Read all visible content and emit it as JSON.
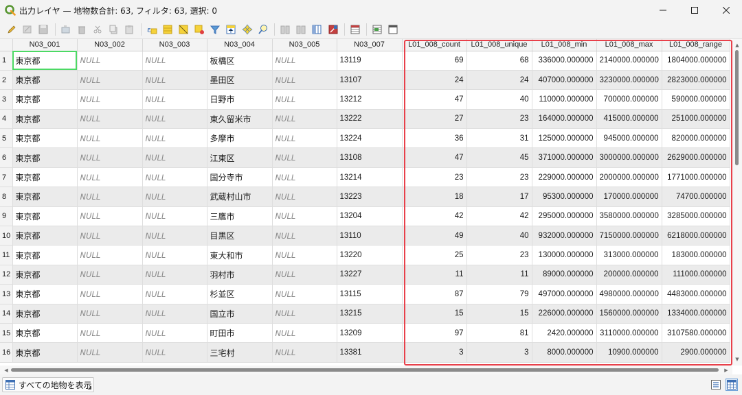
{
  "window": {
    "title": "出力レイヤ — 地物数合計: 63, フィルタ: 63, 選択: 0",
    "minimize_icon": "minimize-icon",
    "maximize_icon": "maximize-icon",
    "close_icon": "close-icon"
  },
  "toolbar": {
    "items": [
      {
        "icon": "pencil-icon"
      },
      {
        "icon": "multi-edit-icon"
      },
      {
        "icon": "save-icon"
      },
      {
        "sep": true
      },
      {
        "icon": "add-feature-icon"
      },
      {
        "icon": "delete-icon"
      },
      {
        "icon": "cut-icon"
      },
      {
        "icon": "copy-icon"
      },
      {
        "icon": "paste-icon"
      },
      {
        "sep": true
      },
      {
        "icon": "expression-select-icon"
      },
      {
        "icon": "select-all-icon"
      },
      {
        "icon": "invert-selection-icon"
      },
      {
        "icon": "deselect-icon"
      },
      {
        "icon": "filter-icon"
      },
      {
        "icon": "move-selection-top-icon"
      },
      {
        "icon": "pan-to-selection-icon"
      },
      {
        "icon": "zoom-to-selection-icon"
      },
      {
        "sep": true
      },
      {
        "icon": "new-field-icon"
      },
      {
        "icon": "delete-field-icon"
      },
      {
        "icon": "organize-columns-icon"
      },
      {
        "icon": "field-calculator-icon"
      },
      {
        "sep": true
      },
      {
        "icon": "conditional-format-icon"
      },
      {
        "sep": true
      },
      {
        "icon": "actions-icon"
      },
      {
        "icon": "dock-icon"
      }
    ]
  },
  "table": {
    "columns": [
      "N03_001",
      "N03_002",
      "N03_003",
      "N03_004",
      "N03_005",
      "N03_007",
      "L01_008_count",
      "L01_008_unique",
      "L01_008_min",
      "L01_008_max",
      "L01_008_range"
    ],
    "rows": [
      {
        "n": "1",
        "c": [
          "東京都",
          "NULL",
          "NULL",
          "板橋区",
          "NULL",
          "13119",
          "69",
          "68",
          "336000.000000",
          "2140000.000000",
          "1804000.000000"
        ]
      },
      {
        "n": "2",
        "c": [
          "東京都",
          "NULL",
          "NULL",
          "墨田区",
          "NULL",
          "13107",
          "24",
          "24",
          "407000.000000",
          "3230000.000000",
          "2823000.000000"
        ]
      },
      {
        "n": "3",
        "c": [
          "東京都",
          "NULL",
          "NULL",
          "日野市",
          "NULL",
          "13212",
          "47",
          "40",
          "110000.000000",
          "700000.000000",
          "590000.000000"
        ]
      },
      {
        "n": "4",
        "c": [
          "東京都",
          "NULL",
          "NULL",
          "東久留米市",
          "NULL",
          "13222",
          "27",
          "23",
          "164000.000000",
          "415000.000000",
          "251000.000000"
        ]
      },
      {
        "n": "5",
        "c": [
          "東京都",
          "NULL",
          "NULL",
          "多摩市",
          "NULL",
          "13224",
          "36",
          "31",
          "125000.000000",
          "945000.000000",
          "820000.000000"
        ]
      },
      {
        "n": "6",
        "c": [
          "東京都",
          "NULL",
          "NULL",
          "江東区",
          "NULL",
          "13108",
          "47",
          "45",
          "371000.000000",
          "3000000.000000",
          "2629000.000000"
        ]
      },
      {
        "n": "7",
        "c": [
          "東京都",
          "NULL",
          "NULL",
          "国分寺市",
          "NULL",
          "13214",
          "23",
          "23",
          "229000.000000",
          "2000000.000000",
          "1771000.000000"
        ]
      },
      {
        "n": "8",
        "c": [
          "東京都",
          "NULL",
          "NULL",
          "武蔵村山市",
          "NULL",
          "13223",
          "18",
          "17",
          "95300.000000",
          "170000.000000",
          "74700.000000"
        ]
      },
      {
        "n": "9",
        "c": [
          "東京都",
          "NULL",
          "NULL",
          "三鷹市",
          "NULL",
          "13204",
          "42",
          "42",
          "295000.000000",
          "3580000.000000",
          "3285000.000000"
        ]
      },
      {
        "n": "10",
        "c": [
          "東京都",
          "NULL",
          "NULL",
          "目黒区",
          "NULL",
          "13110",
          "49",
          "40",
          "932000.000000",
          "7150000.000000",
          "6218000.000000"
        ]
      },
      {
        "n": "11",
        "c": [
          "東京都",
          "NULL",
          "NULL",
          "東大和市",
          "NULL",
          "13220",
          "25",
          "23",
          "130000.000000",
          "313000.000000",
          "183000.000000"
        ]
      },
      {
        "n": "12",
        "c": [
          "東京都",
          "NULL",
          "NULL",
          "羽村市",
          "NULL",
          "13227",
          "11",
          "11",
          "89000.000000",
          "200000.000000",
          "111000.000000"
        ]
      },
      {
        "n": "13",
        "c": [
          "東京都",
          "NULL",
          "NULL",
          "杉並区",
          "NULL",
          "13115",
          "87",
          "79",
          "497000.000000",
          "4980000.000000",
          "4483000.000000"
        ]
      },
      {
        "n": "14",
        "c": [
          "東京都",
          "NULL",
          "NULL",
          "国立市",
          "NULL",
          "13215",
          "15",
          "15",
          "226000.000000",
          "1560000.000000",
          "1334000.000000"
        ]
      },
      {
        "n": "15",
        "c": [
          "東京都",
          "NULL",
          "NULL",
          "町田市",
          "NULL",
          "13209",
          "97",
          "81",
          "2420.000000",
          "3110000.000000",
          "3107580.000000"
        ]
      },
      {
        "n": "16",
        "c": [
          "東京都",
          "NULL",
          "NULL",
          "三宅村",
          "NULL",
          "13381",
          "3",
          "3",
          "8000.000000",
          "10900.000000",
          "2900.000000"
        ]
      }
    ]
  },
  "statusbar": {
    "show_all_label": "すべての地物を表示",
    "form_view_icon": "form-view-icon",
    "table_view_icon": "table-view-icon"
  },
  "colors": {
    "highlight": "#e8404a",
    "selected_cell": "#4cd964",
    "accent": "#2f7ed8"
  }
}
